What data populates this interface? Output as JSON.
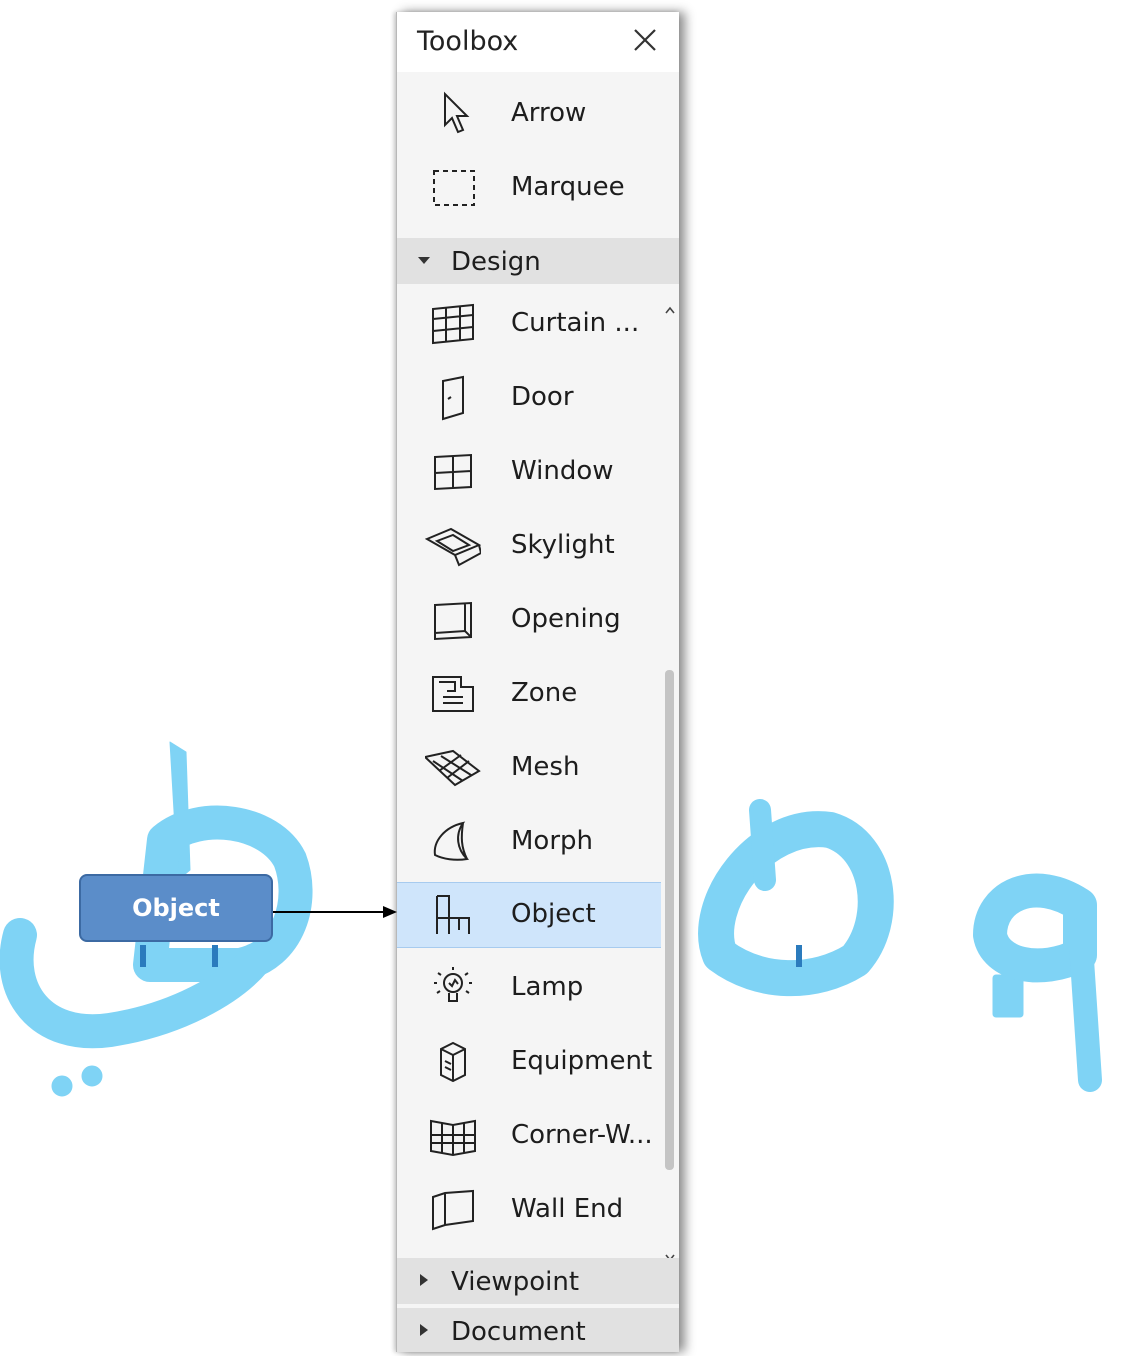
{
  "panel": {
    "title": "Toolbox",
    "close_icon": "close-icon"
  },
  "tools_top": [
    {
      "label": "Arrow",
      "icon": "arrow-icon"
    },
    {
      "label": "Marquee",
      "icon": "marquee-icon"
    }
  ],
  "sections": {
    "design": {
      "label": "Design",
      "expanded": true
    },
    "viewpoint": {
      "label": "Viewpoint",
      "expanded": false
    },
    "document": {
      "label": "Document",
      "expanded": false
    }
  },
  "design_tools": [
    {
      "label": "Curtain ...",
      "icon": "curtain-wall-icon"
    },
    {
      "label": "Door",
      "icon": "door-icon"
    },
    {
      "label": "Window",
      "icon": "window-icon"
    },
    {
      "label": "Skylight",
      "icon": "skylight-icon"
    },
    {
      "label": "Opening",
      "icon": "opening-icon"
    },
    {
      "label": "Zone",
      "icon": "zone-icon"
    },
    {
      "label": "Mesh",
      "icon": "mesh-icon"
    },
    {
      "label": "Morph",
      "icon": "morph-icon"
    },
    {
      "label": "Object",
      "icon": "object-chair-icon",
      "selected": true
    },
    {
      "label": "Lamp",
      "icon": "lamp-icon"
    },
    {
      "label": "Equipment",
      "icon": "equipment-icon"
    },
    {
      "label": "Corner-W...",
      "icon": "corner-window-icon"
    },
    {
      "label": "Wall End",
      "icon": "wall-end-icon"
    }
  ],
  "callout": {
    "label": "Object"
  },
  "watermark": {
    "text": "م. هه علي",
    "color": "#7fd3f5"
  },
  "colors": {
    "selected": "#cfe5fb",
    "section_bg": "#e1e1e1",
    "callout": "#5b8dc9"
  }
}
